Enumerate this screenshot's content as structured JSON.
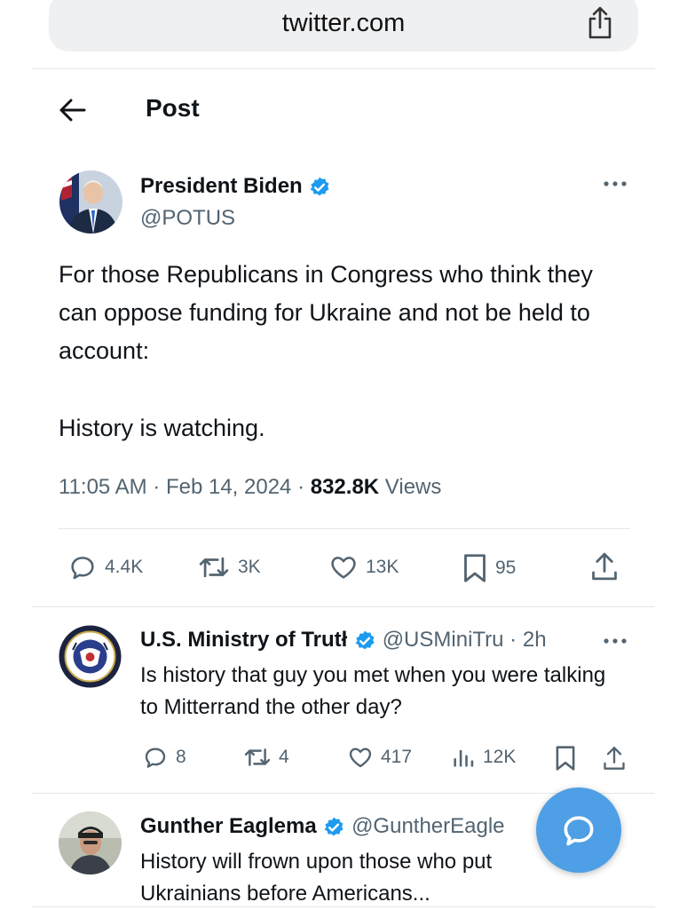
{
  "browser": {
    "url": "twitter.com"
  },
  "header": {
    "title": "Post"
  },
  "main_post": {
    "author_name": "President Biden",
    "author_handle": "@POTUS",
    "text_paragraph_1": "For those Republicans in Congress who think they can oppose funding for Ukraine and not be held to account:",
    "text_paragraph_2": "History is watching.",
    "time": "11:05 AM · Feb 14, 2024 · ",
    "views_count": "832.8K",
    "views_label": " Views",
    "replies": "4.4K",
    "reposts": "3K",
    "likes": "13K",
    "bookmarks": "95"
  },
  "replies": [
    {
      "author_name": "U.S. Ministry of Trutł",
      "author_handle": "@USMiniTru",
      "time": " · 2h",
      "text": "Is history that guy you met when you were talking to Mitterrand the other day?",
      "replies": "8",
      "reposts": "4",
      "likes": "417",
      "views": "12K"
    },
    {
      "author_name": "Gunther Eaglema",
      "author_handle": "@GuntherEagle",
      "text": "History will frown upon those who put Ukrainians before Americans..."
    }
  ],
  "colors": {
    "verified": "#1d9bf0",
    "fab": "#4e9fe5",
    "secondary_text": "#536471"
  },
  "icons": [
    "share-icon",
    "back-arrow-icon",
    "more-icon",
    "verified-badge-icon",
    "reply-icon",
    "repost-icon",
    "like-icon",
    "bookmark-icon",
    "views-icon",
    "compose-reply-icon"
  ]
}
